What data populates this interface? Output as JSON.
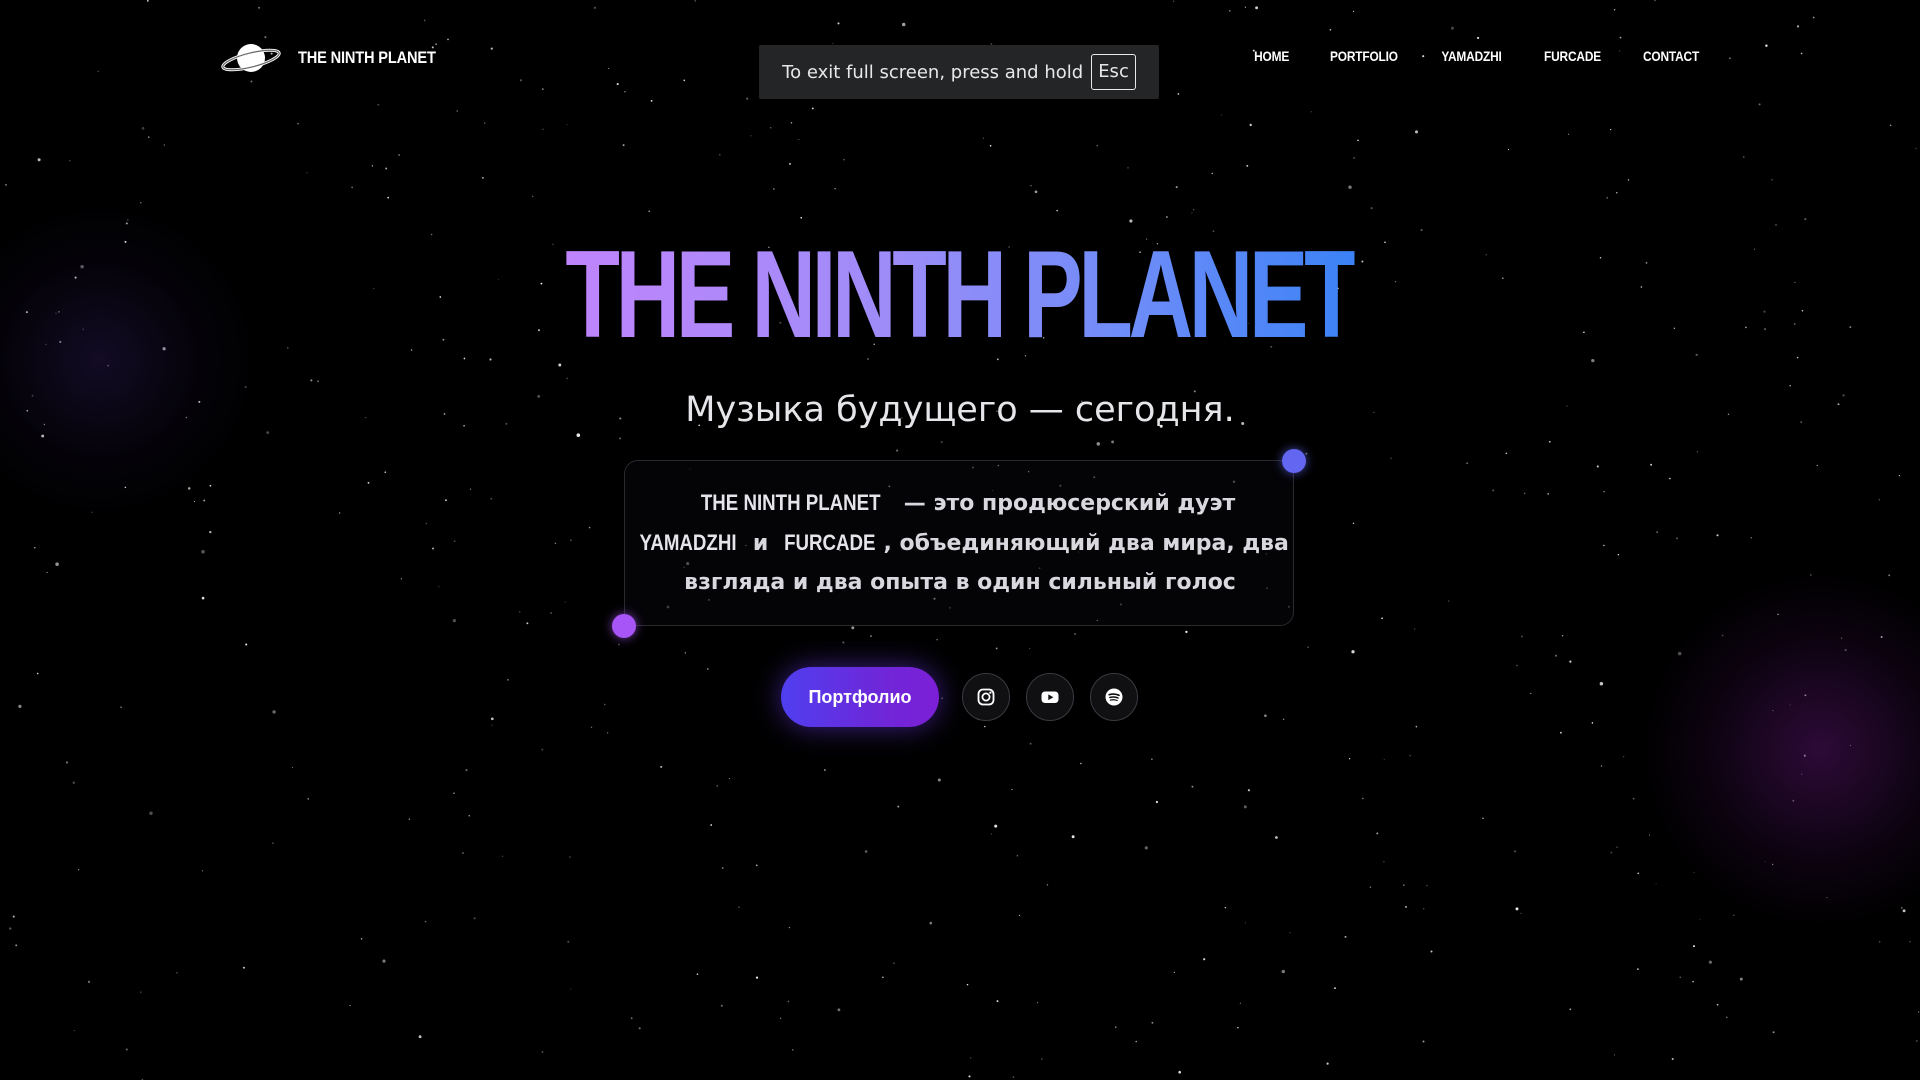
{
  "page": {
    "brand": "THE NINTH PLANET",
    "background_color": "#000000"
  },
  "header": {
    "logo_icon": "ringed-planet-icon",
    "logo_text": "THE NINTH PLANET",
    "nav": [
      {
        "label": "HOME"
      },
      {
        "label": "PORTFOLIO"
      },
      {
        "label": "YAMADZHI"
      },
      {
        "label": "FURCADE"
      },
      {
        "label": "CONTACT"
      }
    ]
  },
  "fullscreen_notice": {
    "message": "To exit full screen, press and hold",
    "key": "Esc"
  },
  "hero": {
    "title": "THE NINTH PLANET",
    "title_gradient": [
      "#c084fc",
      "#3b82f6"
    ],
    "tagline": "Музыка будущего — сегодня.",
    "description": {
      "brand": "THE NINTH PLANET",
      "part1": " — это продюсерский дуэт ",
      "artist1": "YAMADZHI",
      "part2": " и ",
      "artist2": "FURCADE",
      "part3": ", объединяющий два мира, два взгляда и два опыта в один сильный голос"
    },
    "accent_dots": [
      "#6366f1",
      "#a855f7"
    ],
    "cta_label": "Портфолио",
    "cta_gradient": [
      "#4f3ff0",
      "#7c1fd6"
    ],
    "socials": [
      {
        "icon": "instagram-icon"
      },
      {
        "icon": "youtube-icon"
      },
      {
        "icon": "spotify-icon"
      }
    ]
  }
}
